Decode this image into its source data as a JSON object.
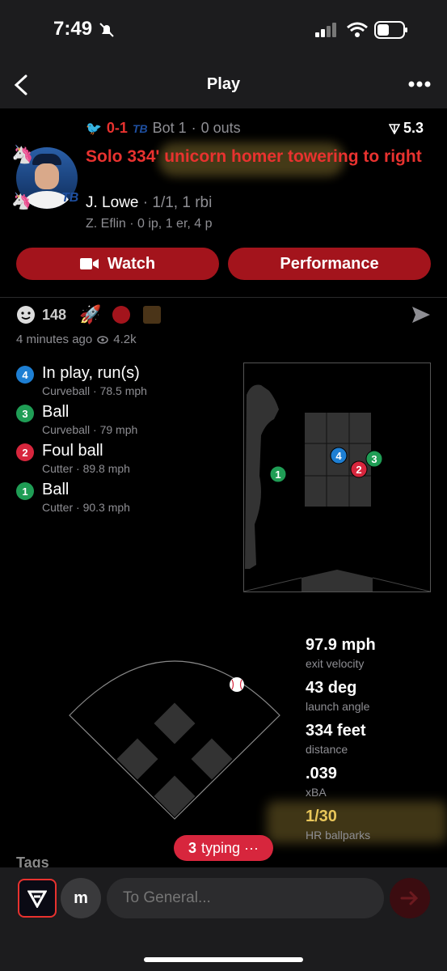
{
  "status_bar": {
    "time": "7:49"
  },
  "nav": {
    "title": "Play"
  },
  "score": {
    "runs": "0-1",
    "inning": "Bot 1",
    "outs": "0 outs",
    "rating": "5.3"
  },
  "play": {
    "headline": "Solo 334' unicorn homer towering to right",
    "batter_name": "J. Lowe",
    "batter_line": "1/1, 1 rbi",
    "pitcher_line": "Z. Eflin · 0 ip, 1 er, 4 p"
  },
  "buttons": {
    "watch": "Watch",
    "performance": "Performance"
  },
  "reactions": {
    "count": "148",
    "time_ago": "4 minutes ago",
    "views": "4.2k"
  },
  "pitches": [
    {
      "num": "4",
      "result": "In play, run(s)",
      "type": "Curveball",
      "speed": "78.5 mph",
      "color": "#1e7fd3"
    },
    {
      "num": "3",
      "result": "Ball",
      "type": "Curveball",
      "speed": "79 mph",
      "color": "#1f9d55"
    },
    {
      "num": "2",
      "result": "Foul ball",
      "type": "Cutter",
      "speed": "89.8 mph",
      "color": "#d7263d"
    },
    {
      "num": "1",
      "result": "Ball",
      "type": "Cutter",
      "speed": "90.3 mph",
      "color": "#1f9d55"
    }
  ],
  "stats": [
    {
      "value": "97.9 mph",
      "label": "exit velocity"
    },
    {
      "value": "43 deg",
      "label": "launch angle"
    },
    {
      "value": "334 feet",
      "label": "distance"
    },
    {
      "value": ".039",
      "label": "xBA"
    },
    {
      "value": "1/30",
      "label": "HR ballparks"
    }
  ],
  "typing": {
    "count": "3",
    "label": "typing ···"
  },
  "section": {
    "tags": "Tags"
  },
  "compose": {
    "avatar_letter": "m",
    "placeholder": "To General..."
  },
  "colors": {
    "accent_red": "#e8322f",
    "button_red": "#a3141c",
    "highlight": "#d4b44a"
  }
}
